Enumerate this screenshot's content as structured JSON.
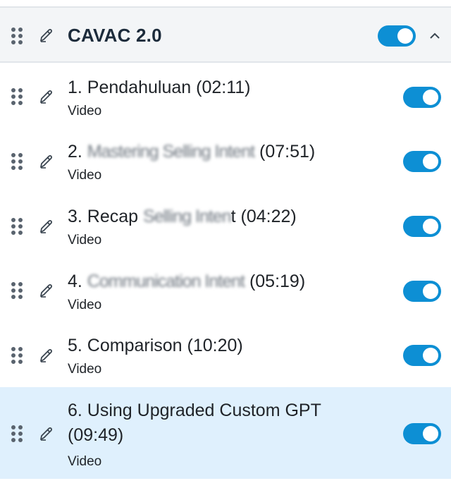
{
  "section": {
    "title": "CAVAC 2.0",
    "enabled": true
  },
  "lessons": [
    {
      "title_prefix": "1. Pendahuluan",
      "title_blur": "",
      "duration": "(02:11)",
      "type": "Video",
      "enabled": true
    },
    {
      "title_prefix": "2. ",
      "title_blur": "Mastering Selling Intent",
      "duration": "(07:51)",
      "type": "Video",
      "enabled": true
    },
    {
      "title_prefix": "3. Recap ",
      "title_blur": "Selling Inten",
      "title_suffix": "t",
      "duration": "(04:22)",
      "type": "Video",
      "enabled": true
    },
    {
      "title_prefix": "4. ",
      "title_blur": "Communication Intent",
      "duration": "(05:19)",
      "type": "Video",
      "enabled": true
    },
    {
      "title_prefix": "5. Comparison",
      "title_blur": "",
      "duration": "(10:20)",
      "type": "Video",
      "enabled": true
    },
    {
      "title_line1": "6. Using Upgraded Custom GPT",
      "title_line2": "(09:49)",
      "type": "Video",
      "enabled": true,
      "selected": true
    }
  ],
  "colors": {
    "toggle_on": "#0d8fd4",
    "header_bg": "#f3f5f7",
    "selected_row_bg": "#dff0fd"
  },
  "icons": {
    "drag": "drag-handle-icon",
    "edit": "pencil-icon",
    "collapse": "chevron-up-icon"
  }
}
